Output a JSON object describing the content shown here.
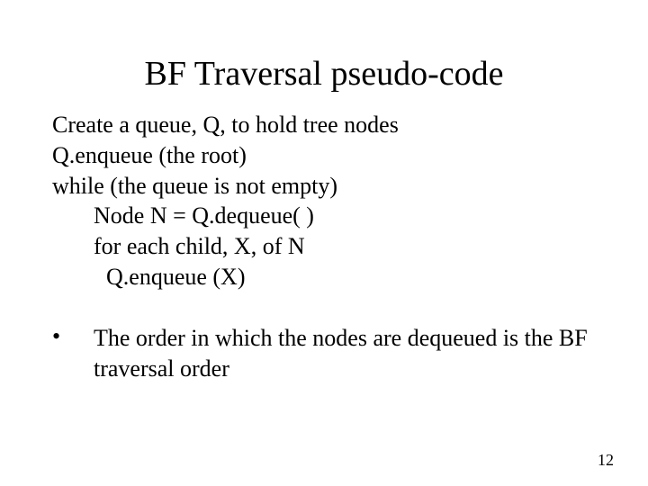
{
  "title": "BF Traversal pseudo-code",
  "code": {
    "l1": "Create a queue, Q, to hold tree nodes",
    "l2": "Q.enqueue (the root)",
    "l3": "while (the queue is not empty)",
    "l4": "Node N = Q.dequeue( )",
    "l5": "for each child, X, of N",
    "l6": "Q.enqueue (X)"
  },
  "bullet": {
    "marker": "•",
    "text": "The order in which the nodes are dequeued is the BF traversal order"
  },
  "page_number": "12"
}
